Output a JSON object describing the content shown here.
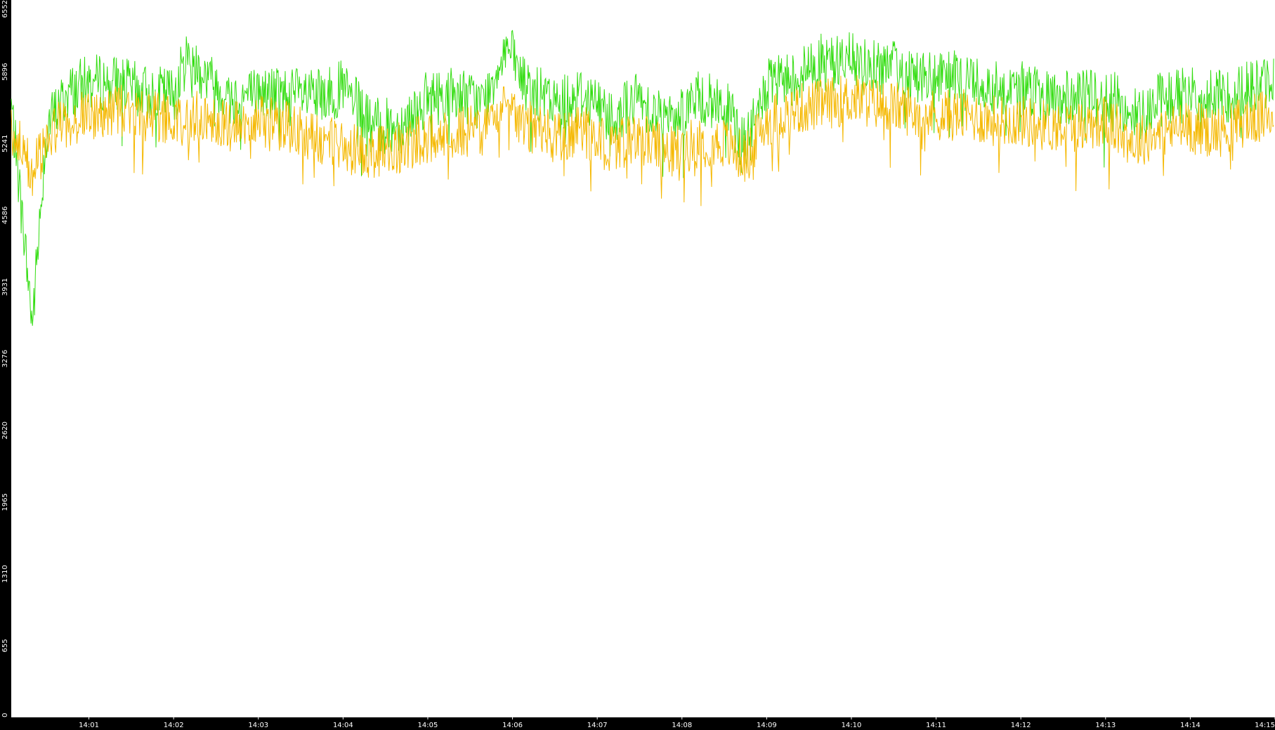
{
  "chart_data": {
    "type": "line",
    "title": "",
    "xlabel": "",
    "ylabel": "",
    "ylim": [
      0,
      6552
    ],
    "yticks": [
      "0",
      "655",
      "1310",
      "1965",
      "2620",
      "3276",
      "3931",
      "4586",
      "5241",
      "5896",
      "6552"
    ],
    "xticks": [
      "14:01",
      "14:02",
      "14:03",
      "14:04",
      "14:05",
      "14:06",
      "14:07",
      "14:08",
      "14:09",
      "14:10",
      "14:11",
      "14:12",
      "14:13",
      "14:14",
      "14:15"
    ],
    "xlim": [
      "14:00:05",
      "14:15:00"
    ],
    "grid": false,
    "legend": "none",
    "colors": {
      "background": "#000000",
      "plot_background": "#ffffff",
      "axis_text": "#ffffff",
      "series_green": "#33dd11",
      "series_orange": "#f5b800"
    },
    "series": [
      {
        "color": "#33dd11",
        "x": [
          "14:00:05",
          "14:00:20",
          "14:00:30",
          "14:00:45",
          "14:01:00",
          "14:01:20",
          "14:01:40",
          "14:02:00",
          "14:02:10",
          "14:02:20",
          "14:02:40",
          "14:03:00",
          "14:03:20",
          "14:03:40",
          "14:04:00",
          "14:04:20",
          "14:04:40",
          "14:05:00",
          "14:05:20",
          "14:05:40",
          "14:05:55",
          "14:06:10",
          "14:06:30",
          "14:06:50",
          "14:07:10",
          "14:07:30",
          "14:07:50",
          "14:08:10",
          "14:08:30",
          "14:08:45",
          "14:09:00",
          "14:09:20",
          "14:09:40",
          "14:10:00",
          "14:10:20",
          "14:10:40",
          "14:11:00",
          "14:11:20",
          "14:11:40",
          "14:12:00",
          "14:12:20",
          "14:12:40",
          "14:13:00",
          "14:13:20",
          "14:13:40",
          "14:14:00",
          "14:14:20",
          "14:14:40",
          "14:14:59"
        ],
        "y": [
          5600,
          3600,
          5400,
          5700,
          5800,
          5800,
          5700,
          5700,
          6050,
          5900,
          5650,
          5700,
          5700,
          5650,
          5750,
          5400,
          5400,
          5650,
          5700,
          5600,
          6150,
          5750,
          5600,
          5700,
          5500,
          5650,
          5450,
          5650,
          5600,
          5200,
          5750,
          5850,
          6000,
          6000,
          5950,
          5900,
          5800,
          5850,
          5750,
          5750,
          5650,
          5650,
          5700,
          5500,
          5650,
          5700,
          5650,
          5750,
          5800
        ]
      },
      {
        "color": "#f5b800",
        "x": [
          "14:00:05",
          "14:00:20",
          "14:00:30",
          "14:00:45",
          "14:01:00",
          "14:01:20",
          "14:01:40",
          "14:02:00",
          "14:02:10",
          "14:02:20",
          "14:02:40",
          "14:03:00",
          "14:03:20",
          "14:03:40",
          "14:04:00",
          "14:04:20",
          "14:04:40",
          "14:05:00",
          "14:05:20",
          "14:05:40",
          "14:05:55",
          "14:06:10",
          "14:06:30",
          "14:06:50",
          "14:07:10",
          "14:07:30",
          "14:07:50",
          "14:08:10",
          "14:08:30",
          "14:08:45",
          "14:09:00",
          "14:09:20",
          "14:09:40",
          "14:10:00",
          "14:10:20",
          "14:10:40",
          "14:11:00",
          "14:11:20",
          "14:11:40",
          "14:12:00",
          "14:12:20",
          "14:12:40",
          "14:13:00",
          "14:13:20",
          "14:13:40",
          "14:14:00",
          "14:14:20",
          "14:14:40",
          "14:14:59"
        ],
        "y": [
          5350,
          5000,
          5300,
          5450,
          5500,
          5550,
          5500,
          5450,
          5450,
          5500,
          5400,
          5450,
          5400,
          5300,
          5200,
          5150,
          5200,
          5300,
          5350,
          5350,
          5550,
          5400,
          5300,
          5350,
          5200,
          5300,
          5150,
          5250,
          5250,
          5100,
          5450,
          5550,
          5600,
          5650,
          5600,
          5550,
          5500,
          5500,
          5450,
          5450,
          5400,
          5400,
          5450,
          5250,
          5350,
          5400,
          5350,
          5450,
          5500
        ]
      }
    ]
  }
}
